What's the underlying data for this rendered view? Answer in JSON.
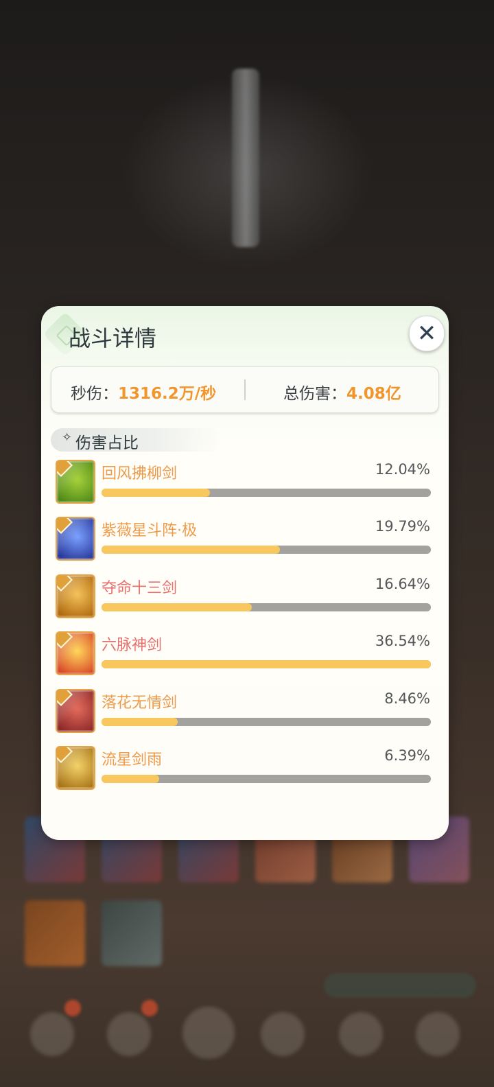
{
  "panel": {
    "title": "战斗详情",
    "close_icon": "close-icon",
    "stats": {
      "dps_label": "秒伤：",
      "dps_value": "1316.2万/秒",
      "total_label": "总伤害：",
      "total_value": "4.08亿"
    },
    "section": {
      "icon": "diamond-sparkle-icon",
      "label": "伤害占比"
    },
    "skills": [
      {
        "name": "回风拂柳剑",
        "percent_text": "12.04%",
        "share": 0.3295,
        "icon": "wind-swirl-skill-icon",
        "colors": [
          "#a7d13b",
          "#4f8a18"
        ],
        "name_color": "#ed9a4a"
      },
      {
        "name": "紫薇星斗阵·极",
        "percent_text": "19.79%",
        "share": 0.5416,
        "icon": "star-array-skill-icon",
        "colors": [
          "#7aa0ff",
          "#2a3a9c"
        ],
        "name_color": "#ed9a4a"
      },
      {
        "name": "夺命十三剑",
        "percent_text": "16.64%",
        "share": 0.4554,
        "icon": "thirteen-swords-skill-icon",
        "colors": [
          "#f4c25a",
          "#b06a10"
        ],
        "name_color": "#e8706e"
      },
      {
        "name": "六脉神剑",
        "percent_text": "36.54%",
        "share": 1.0,
        "icon": "six-meridian-sword-skill-icon",
        "colors": [
          "#ffd75a",
          "#d84a2a"
        ],
        "name_color": "#e8706e"
      },
      {
        "name": "落花无情剑",
        "percent_text": "8.46%",
        "share": 0.2315,
        "icon": "falling-blossom-sword-skill-icon",
        "colors": [
          "#e46a5a",
          "#8d2a2a"
        ],
        "name_color": "#ed9a4a"
      },
      {
        "name": "流星剑雨",
        "percent_text": "6.39%",
        "share": 0.1749,
        "icon": "meteor-sword-rain-skill-icon",
        "colors": [
          "#f3d26a",
          "#a87416"
        ],
        "name_color": "#ed9a4a"
      }
    ]
  },
  "colors": {
    "accent": "#f0962d",
    "bar_fill": "#f8c75e",
    "bar_track": "#a3a29e"
  }
}
